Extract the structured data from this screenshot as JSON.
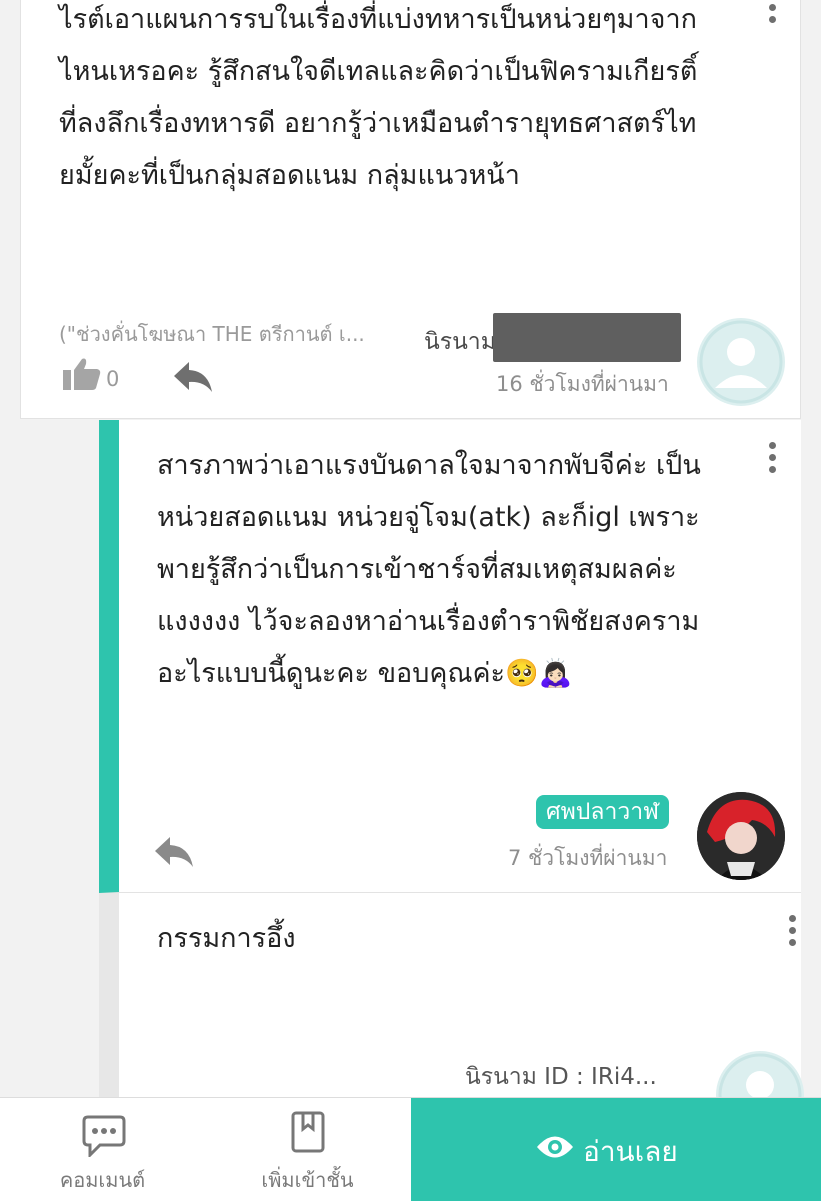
{
  "comment1": {
    "text": "ไรต์เอาแผนการรบในเรื่องที่แบ่งทหารเป็นหน่วยๆมาจาก\nไหนเหรอคะ รู้สึกสนใจดีเทลและคิดว่าเป็นฟิครามเกียรติ์\nที่ลงลึกเรื่องทหารดี อยากรู้ว่าเหมือนตำรายุทธศาสตร์ไท\nยมั้ยคะที่เป็นกลุ่มสอดแนม กลุ่มแนวหน้า",
    "quote": "(\"ช่วงคั่นโฆษณา THE ตรีกานต์ เ...",
    "author": "นิรนาม",
    "time": "16 ชั่วโมงที่ผ่านมา",
    "like_count": "0"
  },
  "comment2": {
    "text": "สารภาพว่าเอาแรงบันดาลใจมาจากพับจีค่ะ เป็น\nหน่วยสอดแนม หน่วยจู่โจม(atk) ละก็igl เพราะ\nพายรู้สึกว่าเป็นการเข้าชาร์จที่สมเหตุสมผลค่ะ\nแงงงงง ไว้จะลองหาอ่านเรื่องตำราพิชัยสงคราม\nอะไรแบบนี้ดูนะคะ ขอบคุณค่ะ🥺🙇🏻‍♀️",
    "author": "ศพปลาวาฬ",
    "time": "7 ชั่วโมงที่ผ่านมา"
  },
  "comment3": {
    "text": "กรรมการอึ้ง",
    "author": "นิรนาม ID : IRi4..."
  },
  "bottom_bar": {
    "comment_label": "คอมเมนต์",
    "shelf_label": "เพิ่มเข้าชั้น",
    "read_label": "อ่านเลย"
  },
  "colors": {
    "accent": "#2ec4ad",
    "thread_line": "#e7e7e7"
  },
  "icons": [
    "more-vertical-icon",
    "thumbs-up-icon",
    "reply-icon",
    "user-avatar-icon",
    "comment-icon",
    "bookmark-icon",
    "eye-icon"
  ]
}
